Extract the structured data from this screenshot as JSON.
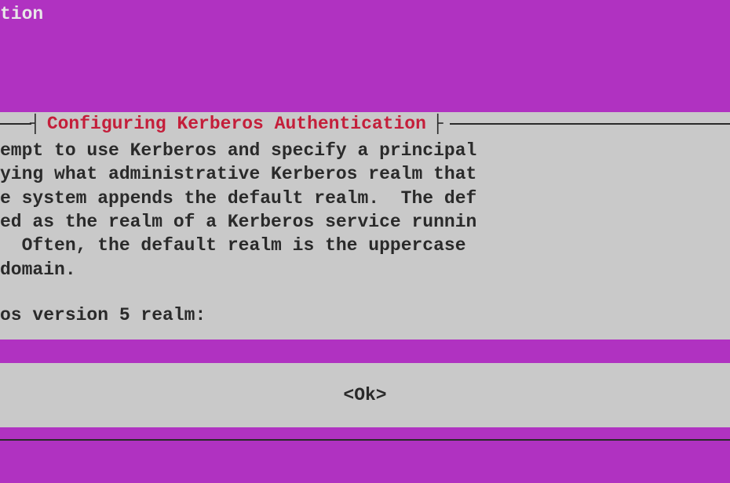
{
  "fragments": {
    "top": "tion"
  },
  "dialog": {
    "title": "Configuring Kerberos Authentication",
    "body_visible": "empt to use Kerberos and specify a principal\nying what administrative Kerberos realm that\ne system appends the default realm.  The def\ned as the realm of a Kerberos service runnin\n  Often, the default realm is the uppercase\ndomain.",
    "prompt_visible": "os version 5 realm:",
    "ok_label": "<Ok>"
  },
  "colors": {
    "background": "#b032c1",
    "panel": "#c9c9c9",
    "text": "#2a2a2a",
    "title": "#c41e3a",
    "top_text": "#e8e8e8"
  }
}
